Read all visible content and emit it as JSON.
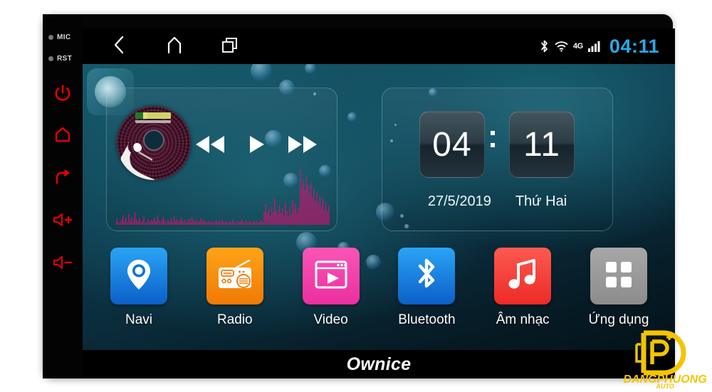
{
  "device": {
    "brand_text": "Ownice",
    "hardware_labels": [
      {
        "name": "mic-indicator",
        "label": "MIC"
      },
      {
        "name": "reset-indicator",
        "label": "RST"
      }
    ],
    "hardware_buttons": [
      {
        "name": "power-button",
        "icon": "power-icon",
        "label": "Power"
      },
      {
        "name": "home-button",
        "icon": "home-icon",
        "label": "Home"
      },
      {
        "name": "back-button",
        "icon": "back-arrow-icon",
        "label": "Back"
      },
      {
        "name": "volume-up-button",
        "icon": "volume-up-icon",
        "label": "Volume Up"
      },
      {
        "name": "volume-down-button",
        "icon": "volume-down-icon",
        "label": "Volume Down"
      }
    ],
    "accent_red": "#e60000"
  },
  "statusbar": {
    "nav_keys": [
      {
        "name": "nav-back",
        "icon": "chevron-left-icon",
        "label": "Back"
      },
      {
        "name": "nav-home",
        "icon": "home-outline-icon",
        "label": "Home"
      },
      {
        "name": "nav-recents",
        "icon": "recents-squares-icon",
        "label": "Recents"
      }
    ],
    "bluetooth_icon": "bluetooth-icon",
    "wifi_icon": "wifi-icon",
    "network_label": "4G",
    "signal_icon": "signal-bars-icon",
    "clock": "04:11",
    "clock_color": "#2aa8e8"
  },
  "music_widget": {
    "album_art": "cd-disc-art",
    "controls": [
      {
        "name": "previous-button",
        "icon": "rewind-icon",
        "label": "Previous"
      },
      {
        "name": "play-button",
        "icon": "play-icon",
        "label": "Play"
      },
      {
        "name": "next-button",
        "icon": "fast-forward-icon",
        "label": "Next"
      }
    ],
    "visualizer_color": "#ea0a73",
    "visualizer_levels": [
      10,
      5,
      3,
      7,
      16,
      6,
      12,
      4,
      18,
      7,
      13,
      5,
      21,
      9,
      6,
      11,
      4,
      7,
      14,
      3,
      5,
      9,
      4,
      8,
      6,
      12,
      5,
      16,
      7,
      4,
      9,
      13,
      6,
      3,
      8,
      5,
      11,
      4,
      14,
      6,
      9,
      4,
      7,
      12,
      5,
      8,
      3,
      6,
      10,
      4,
      13,
      7,
      5,
      9,
      3,
      6,
      11,
      4,
      8,
      5,
      3,
      7,
      4,
      6,
      3,
      5,
      8,
      4,
      6,
      3,
      9,
      5,
      4,
      7,
      3,
      6,
      4,
      8,
      5,
      3,
      7,
      4,
      6,
      9,
      5,
      3,
      8,
      4,
      6,
      5,
      3,
      7,
      4,
      6,
      3,
      5,
      8,
      4,
      22,
      34,
      19,
      26,
      15,
      30,
      21,
      44,
      24,
      18,
      32,
      20,
      27,
      16,
      38,
      23,
      14,
      31,
      18,
      42,
      26,
      35,
      19,
      29,
      92,
      62,
      74,
      58,
      80,
      66,
      52,
      70,
      46,
      60,
      40,
      54,
      36,
      48,
      30,
      44,
      26,
      38,
      22,
      32
    ]
  },
  "clock_widget": {
    "hour": "04",
    "minute": "11",
    "separator": ":",
    "date": "27/5/2019",
    "weekday": "Thứ Hai"
  },
  "apps": [
    {
      "name": "app-navi",
      "label": "Navi",
      "icon": "map-pin-icon",
      "color_top": "#2ba4f5",
      "color_bottom": "#0b5fc8"
    },
    {
      "name": "app-radio",
      "label": "Radio",
      "icon": "radio-icon",
      "color_top": "#ffa317",
      "color_bottom": "#f07a05"
    },
    {
      "name": "app-video",
      "label": "Video",
      "icon": "video-play-icon",
      "color_top": "#f955b6",
      "color_bottom": "#ec2fa0"
    },
    {
      "name": "app-bluetooth",
      "label": "Bluetooth",
      "icon": "bluetooth-icon",
      "color_top": "#2ba4f5",
      "color_bottom": "#0b5fc8"
    },
    {
      "name": "app-music",
      "label": "Âm nhạc",
      "icon": "music-note-icon",
      "color_top": "#fc5a52",
      "color_bottom": "#ee2a26"
    },
    {
      "name": "app-apps",
      "label": "Ứng dụng",
      "icon": "app-grid-icon",
      "color_top": "#a7a7a7",
      "color_bottom": "#8c8c8c"
    }
  ],
  "watermark": {
    "monogram": "DP",
    "line1": "DANGPHUONG",
    "line2": "AUTO",
    "color": "#f5c400"
  }
}
